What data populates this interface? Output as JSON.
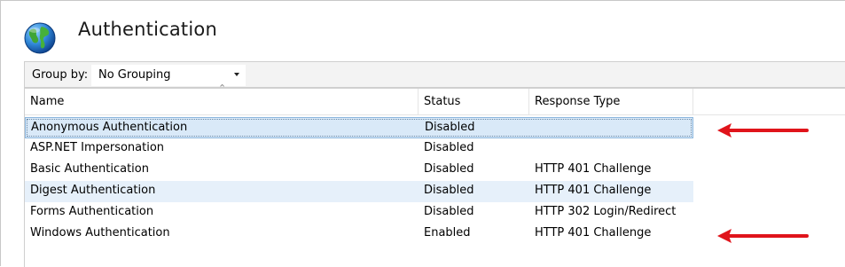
{
  "header": {
    "title": "Authentication",
    "icon": "globe-icon"
  },
  "toolbar": {
    "group_by_label": "Group by:",
    "group_by_value": "No Grouping"
  },
  "table": {
    "columns": [
      "Name",
      "Status",
      "Response Type"
    ],
    "sorted_column": "Name",
    "rows": [
      {
        "name": "Anonymous Authentication",
        "status": "Disabled",
        "response": "",
        "state": "selected"
      },
      {
        "name": "ASP.NET Impersonation",
        "status": "Disabled",
        "response": "",
        "state": ""
      },
      {
        "name": "Basic Authentication",
        "status": "Disabled",
        "response": "HTTP 401 Challenge",
        "state": ""
      },
      {
        "name": "Digest Authentication",
        "status": "Disabled",
        "response": "HTTP 401 Challenge",
        "state": "hover"
      },
      {
        "name": "Forms Authentication",
        "status": "Disabled",
        "response": "HTTP 302 Login/Redirect",
        "state": ""
      },
      {
        "name": "Windows Authentication",
        "status": "Enabled",
        "response": "HTTP 401 Challenge",
        "state": ""
      }
    ]
  },
  "annotations": {
    "arrow_color": "#e0141b",
    "arrow_targets": [
      "Anonymous Authentication",
      "Windows Authentication"
    ]
  },
  "colors": {
    "selection_bg": "#d9e9f8",
    "selection_border": "#8cb6dd",
    "hover_bg": "#e6f0fa"
  }
}
